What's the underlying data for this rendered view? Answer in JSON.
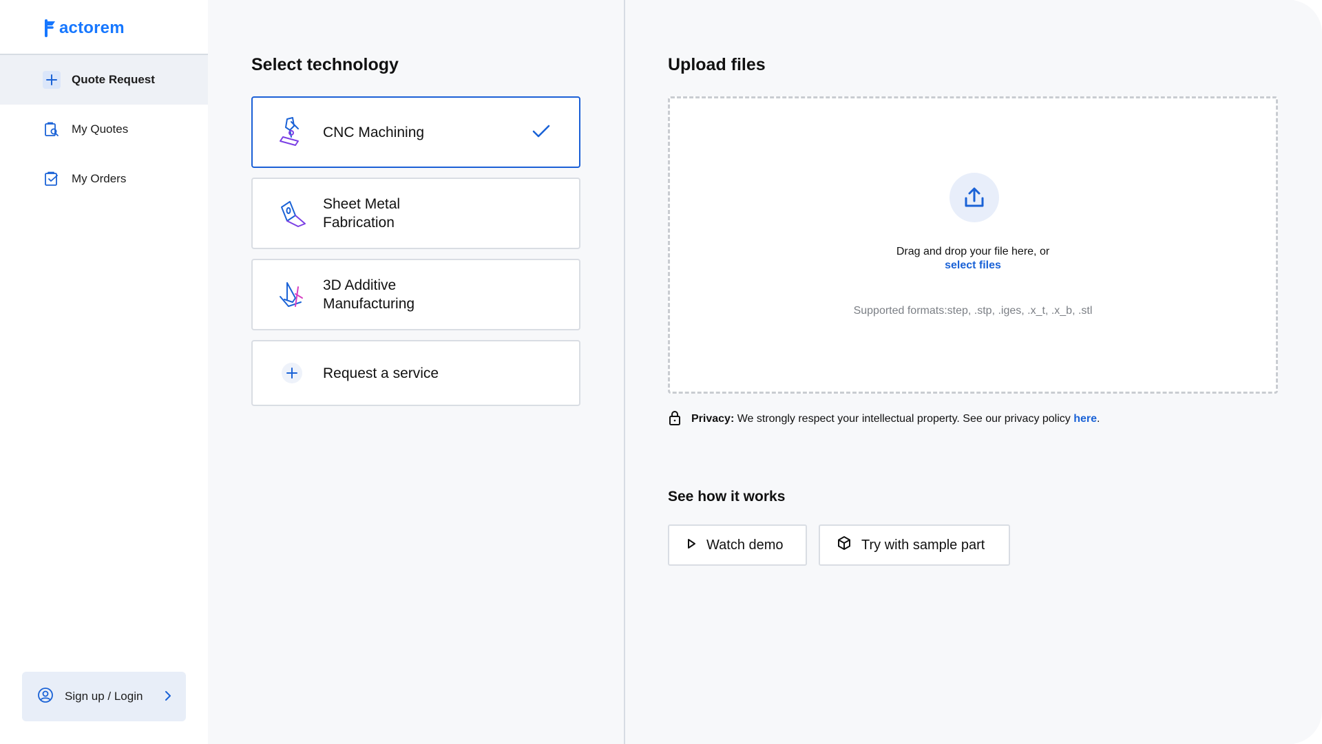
{
  "brand": {
    "name": "actorem",
    "color": "#1677ff"
  },
  "sidebar": {
    "items": [
      {
        "label": "Quote Request",
        "icon": "plus-icon",
        "active": true
      },
      {
        "label": "My Quotes",
        "icon": "clipboard-search-icon",
        "active": false
      },
      {
        "label": "My Orders",
        "icon": "clipboard-check-icon",
        "active": false
      }
    ],
    "login_label": "Sign up / Login"
  },
  "technology": {
    "title": "Select technology",
    "options": [
      {
        "label": "CNC Machining",
        "icon": "cnc-machining-icon",
        "selected": true
      },
      {
        "label": "Sheet Metal Fabrication",
        "icon": "sheet-metal-icon",
        "selected": false
      },
      {
        "label": "3D Additive Manufacturing",
        "icon": "3d-printing-icon",
        "selected": false
      },
      {
        "label": "Request a service",
        "icon": "plus-icon",
        "selected": false
      }
    ]
  },
  "upload": {
    "title": "Upload files",
    "drag_text": "Drag and drop your file here, or",
    "select_link": "select files",
    "formats": "Supported formats:step, .stp, .iges, .x_t, .x_b, .stl"
  },
  "privacy": {
    "label": "Privacy:",
    "text": "We strongly respect your intellectual property. See our privacy policy",
    "link": "here",
    "end": "."
  },
  "how": {
    "title": "See how it works",
    "watch_demo": "Watch demo",
    "sample_part": "Try with sample part"
  },
  "colors": {
    "accent": "#1a62d6",
    "selected_border": "#1a5fd6",
    "background": "#f7f8fa"
  }
}
